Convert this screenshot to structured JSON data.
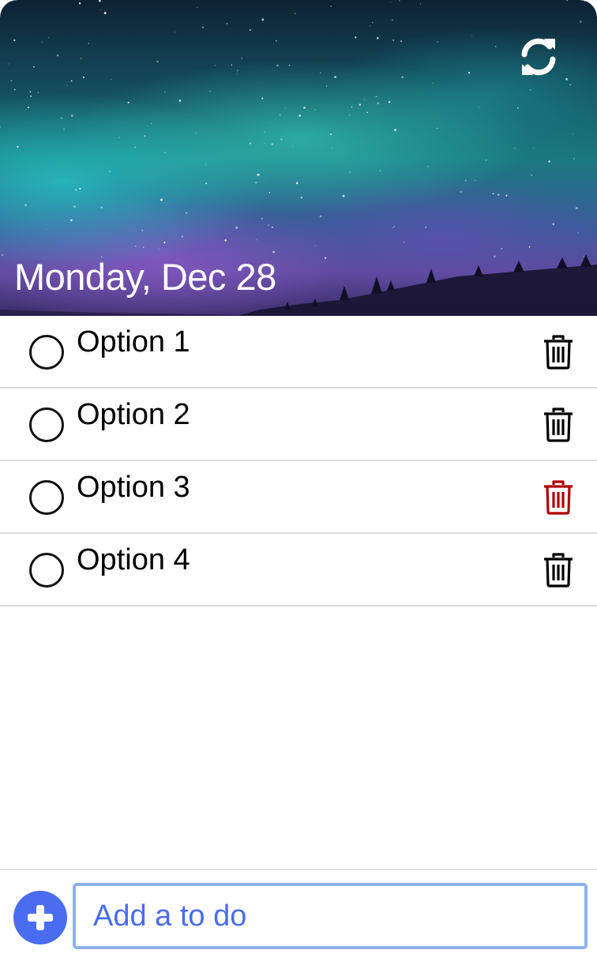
{
  "header": {
    "date": "Monday, Dec 28",
    "refresh_icon": "refresh-icon"
  },
  "todos": [
    {
      "label": "Option 1",
      "checked": false,
      "delete_color": "#000000"
    },
    {
      "label": "Option 2",
      "checked": false,
      "delete_color": "#000000"
    },
    {
      "label": "Option 3",
      "checked": false,
      "delete_color": "#b00000"
    },
    {
      "label": "Option 4",
      "checked": false,
      "delete_color": "#000000"
    }
  ],
  "footer": {
    "add_icon": "plus-circle-icon",
    "input_placeholder": "Add a to do",
    "input_value": ""
  },
  "colors": {
    "accent": "#4a6cf0",
    "input_border": "#8db2ef",
    "delete_hover": "#b00000"
  }
}
